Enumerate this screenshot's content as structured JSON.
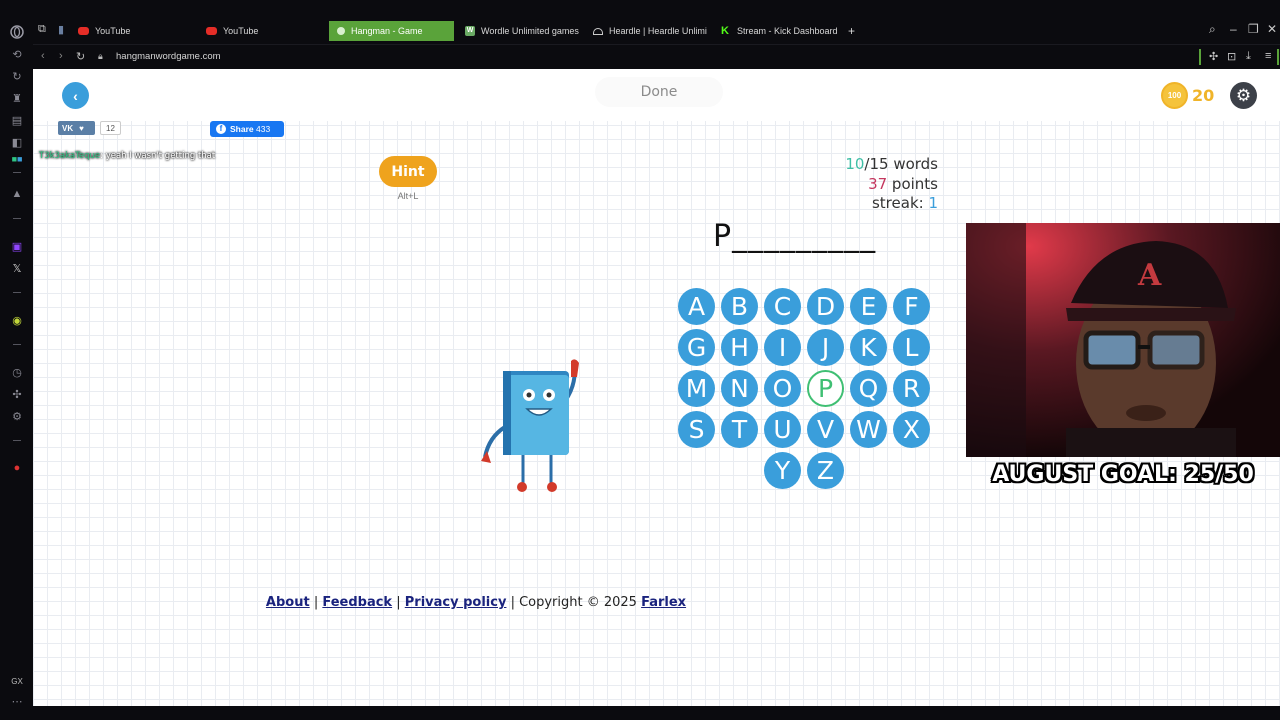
{
  "browser": {
    "tabs": [
      {
        "label": "YouTube",
        "favicon": "youtube-icon"
      },
      {
        "label": "YouTube",
        "favicon": "youtube-icon"
      },
      {
        "label": "Hangman - Game",
        "favicon": "hangman-icon",
        "active": true
      },
      {
        "label": "Wordle Unlimited games",
        "favicon": "wordle-icon"
      },
      {
        "label": "Heardle | Heardle Unlimit",
        "favicon": "headphones-icon"
      },
      {
        "label": "Stream - Kick Dashboard",
        "favicon": "kick-icon"
      }
    ],
    "new_tab": "+",
    "url": "hangmanwordgame.com",
    "accent": "#5aa33a",
    "sidebar_badge": "GX"
  },
  "header": {
    "done_label": "Done",
    "coins": "20",
    "coin_icon": "coin-icon",
    "back_icon": "chevron-left-icon",
    "settings_icon": "gear-icon"
  },
  "social": {
    "vk_label": "VK",
    "vk_count": "12",
    "fb_label": "Share",
    "fb_count": "433"
  },
  "chat": {
    "user": "T3k3akaTeque",
    "message": ": yeah I wasn't getting that"
  },
  "hint": {
    "label": "Hint",
    "shortcut": "Alt+L"
  },
  "score": {
    "words_done": "10",
    "words_total": "/15 words",
    "points": "37",
    "points_label": " points",
    "streak_label": "streak: ",
    "streak": "1"
  },
  "puzzle": {
    "word_display": "P_________"
  },
  "keyboard": {
    "rows": [
      [
        "A",
        "B",
        "C",
        "D",
        "E",
        "F"
      ],
      [
        "G",
        "H",
        "I",
        "J",
        "K",
        "L"
      ],
      [
        "M",
        "N",
        "O",
        "P",
        "Q",
        "R"
      ],
      [
        "S",
        "T",
        "U",
        "V",
        "W",
        "X"
      ],
      [
        "Y",
        "Z"
      ]
    ],
    "used": [
      "P"
    ]
  },
  "footer": {
    "about": "About",
    "sep": " | ",
    "feedback": "Feedback",
    "privacy": "Privacy policy",
    "copyright": " | Copyright © 2025 ",
    "farlex": "Farlex"
  },
  "overlay": {
    "goal": "AUGUST GOAL: 25/50"
  },
  "colors": {
    "key_blue": "#3a9edb",
    "hint_orange": "#efa31d",
    "used_green": "#3fbf73",
    "teal": "#3fbfa6",
    "points_red": "#c4375f"
  }
}
